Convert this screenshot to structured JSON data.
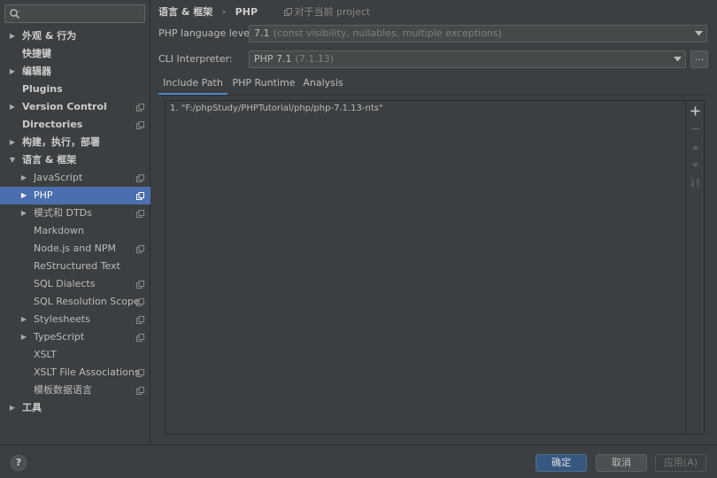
{
  "sidebar": {
    "search": {
      "value": "",
      "placeholder": ""
    },
    "items": [
      {
        "label": "外观 & 行为",
        "arrow": "▶",
        "bold": true,
        "indent": 0,
        "copy": false,
        "selected": false
      },
      {
        "label": "快捷键",
        "arrow": "",
        "bold": true,
        "indent": 0,
        "copy": false,
        "selected": false
      },
      {
        "label": "编辑器",
        "arrow": "▶",
        "bold": true,
        "indent": 0,
        "copy": false,
        "selected": false
      },
      {
        "label": "Plugins",
        "arrow": "",
        "bold": true,
        "indent": 0,
        "copy": false,
        "selected": false
      },
      {
        "label": "Version Control",
        "arrow": "▶",
        "bold": true,
        "indent": 0,
        "copy": true,
        "selected": false
      },
      {
        "label": "Directories",
        "arrow": "",
        "bold": true,
        "indent": 0,
        "copy": true,
        "selected": false
      },
      {
        "label": "构建，执行，部署",
        "arrow": "▶",
        "bold": true,
        "indent": 0,
        "copy": false,
        "selected": false
      },
      {
        "label": "语言 & 框架",
        "arrow": "▼",
        "bold": true,
        "indent": 0,
        "copy": false,
        "selected": false
      },
      {
        "label": "JavaScript",
        "arrow": "▶",
        "bold": false,
        "indent": 1,
        "copy": true,
        "selected": false
      },
      {
        "label": "PHP",
        "arrow": "▶",
        "bold": false,
        "indent": 1,
        "copy": true,
        "selected": true
      },
      {
        "label": "模式和 DTDs",
        "arrow": "▶",
        "bold": false,
        "indent": 1,
        "copy": true,
        "selected": false
      },
      {
        "label": "Markdown",
        "arrow": "",
        "bold": false,
        "indent": 1,
        "copy": false,
        "selected": false
      },
      {
        "label": "Node.js and NPM",
        "arrow": "",
        "bold": false,
        "indent": 1,
        "copy": true,
        "selected": false
      },
      {
        "label": "ReStructured Text",
        "arrow": "",
        "bold": false,
        "indent": 1,
        "copy": false,
        "selected": false
      },
      {
        "label": "SQL Dialects",
        "arrow": "",
        "bold": false,
        "indent": 1,
        "copy": true,
        "selected": false
      },
      {
        "label": "SQL Resolution Scopes",
        "arrow": "",
        "bold": false,
        "indent": 1,
        "copy": true,
        "selected": false
      },
      {
        "label": "Stylesheets",
        "arrow": "▶",
        "bold": false,
        "indent": 1,
        "copy": true,
        "selected": false
      },
      {
        "label": "TypeScript",
        "arrow": "▶",
        "bold": false,
        "indent": 1,
        "copy": true,
        "selected": false
      },
      {
        "label": "XSLT",
        "arrow": "",
        "bold": false,
        "indent": 1,
        "copy": false,
        "selected": false
      },
      {
        "label": "XSLT File Associations",
        "arrow": "",
        "bold": false,
        "indent": 1,
        "copy": true,
        "selected": false
      },
      {
        "label": "模板数据语言",
        "arrow": "",
        "bold": false,
        "indent": 1,
        "copy": true,
        "selected": false
      },
      {
        "label": "工具",
        "arrow": "▶",
        "bold": true,
        "indent": 0,
        "copy": false,
        "selected": false
      }
    ]
  },
  "breadcrumb": {
    "parent": "语言 & 框架",
    "separator": "›",
    "current": "PHP",
    "project_note": "对于当前 project"
  },
  "settings": {
    "language_level": {
      "label": "PHP language level:",
      "value": "7.1",
      "hint": "(const visibility, nullables, multiple exceptions)"
    },
    "cli_interpreter": {
      "label": "CLI Interpreter:",
      "value": "PHP 7.1",
      "hint": "(7.1.13)",
      "browse_label": "..."
    }
  },
  "tabs": [
    {
      "label": "Include Path",
      "active": true
    },
    {
      "label": "PHP Runtime",
      "active": false
    },
    {
      "label": "Analysis",
      "active": false
    }
  ],
  "include_paths": [
    "1. \"F:/phpStudy/PHPTutorial/php/php-7.1.13-nts\""
  ],
  "footer": {
    "help_label": "?",
    "ok_label": "确定",
    "cancel_label": "取消",
    "apply_label": "应用(A)"
  },
  "colors": {
    "background": "#3c3f41",
    "selection": "#4b6eaf",
    "tab_underline": "#4a88c7",
    "primary_button": "#365880"
  }
}
